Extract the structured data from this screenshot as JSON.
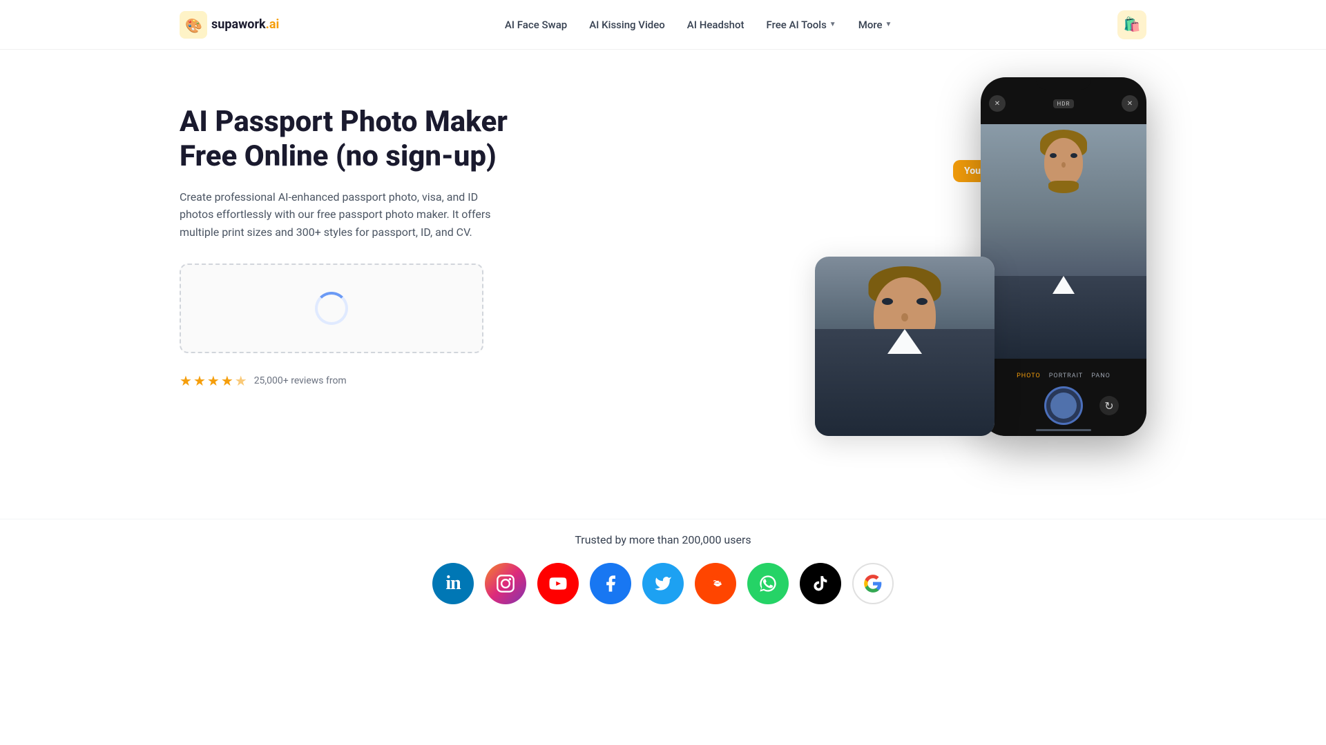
{
  "navbar": {
    "logo_text": "supawork",
    "logo_suffix": ".ai",
    "links": [
      {
        "id": "ai-face-swap",
        "label": "AI Face Swap",
        "dropdown": false
      },
      {
        "id": "ai-kissing-video",
        "label": "AI Kissing Video",
        "dropdown": false
      },
      {
        "id": "ai-headshot",
        "label": "AI Headshot",
        "dropdown": false
      },
      {
        "id": "free-ai-tools",
        "label": "Free AI Tools",
        "dropdown": true
      },
      {
        "id": "more",
        "label": "More",
        "dropdown": true
      }
    ]
  },
  "hero": {
    "title": "AI Passport Photo Maker Free Online (no sign-up)",
    "description": "Create professional AI-enhanced passport photo, visa, and ID photos effortlessly with our free passport photo maker. It offers multiple print sizes and 300+ styles for passport, ID, and CV.",
    "reviews": {
      "count": "25,000+",
      "text": "25,000+ reviews from",
      "stars": 4.5
    }
  },
  "your_image_label": "Your Image",
  "phone": {
    "mode_tabs": [
      "PHOTO",
      "PORTRAIT",
      "PANO"
    ],
    "active_tab": "PHOTO",
    "hdr_label": "HDR"
  },
  "trust": {
    "text": "Trusted by more than 200,000 users"
  },
  "social_icons": [
    {
      "id": "linkedin",
      "label": "in",
      "class": "si-linkedin"
    },
    {
      "id": "instagram",
      "label": "📷",
      "class": "si-instagram"
    },
    {
      "id": "youtube",
      "label": "▶",
      "class": "si-youtube"
    },
    {
      "id": "facebook",
      "label": "f",
      "class": "si-facebook"
    },
    {
      "id": "twitter",
      "label": "𝕏",
      "class": "si-twitter"
    },
    {
      "id": "reddit",
      "label": "👽",
      "class": "si-reddit"
    },
    {
      "id": "whatsapp",
      "label": "📱",
      "class": "si-whatsapp"
    },
    {
      "id": "tiktok",
      "label": "♪",
      "class": "si-tiktok"
    },
    {
      "id": "google",
      "label": "G",
      "class": "si-google"
    }
  ]
}
